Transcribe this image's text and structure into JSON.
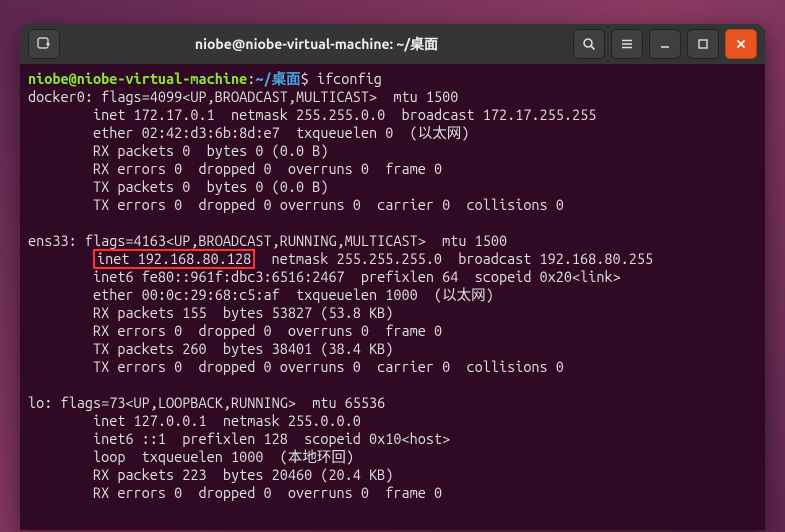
{
  "titlebar": {
    "title": "niobe@niobe-virtual-machine: ~/桌面"
  },
  "prompt": {
    "user_host": "niobe@niobe-virtual-machine",
    "path": "~/桌面",
    "dollar": "$",
    "command": "ifconfig"
  },
  "interfaces": [
    {
      "name": "docker0",
      "header": "docker0: flags=4099<UP,BROADCAST,MULTICAST>  mtu 1500",
      "lines": [
        "        inet 172.17.0.1  netmask 255.255.0.0  broadcast 172.17.255.255",
        "        ether 02:42:d3:6b:8d:e7  txqueuelen 0  (以太网)",
        "        RX packets 0  bytes 0 (0.0 B)",
        "        RX errors 0  dropped 0  overruns 0  frame 0",
        "        TX packets 0  bytes 0 (0.0 B)",
        "        TX errors 0  dropped 0 overruns 0  carrier 0  collisions 0"
      ]
    },
    {
      "name": "ens33",
      "header": "ens33: flags=4163<UP,BROADCAST,RUNNING,MULTICAST>  mtu 1500",
      "inet_prefix": "        ",
      "inet_highlight": "inet 192.168.80.128",
      "inet_suffix": "  netmask 255.255.255.0  broadcast 192.168.80.255",
      "lines": [
        "        inet6 fe80::961f:dbc3:6516:2467  prefixlen 64  scopeid 0x20<link>",
        "        ether 00:0c:29:68:c5:af  txqueuelen 1000  (以太网)",
        "        RX packets 155  bytes 53827 (53.8 KB)",
        "        RX errors 0  dropped 0  overruns 0  frame 0",
        "        TX packets 260  bytes 38401 (38.4 KB)",
        "        TX errors 0  dropped 0 overruns 0  carrier 0  collisions 0"
      ]
    },
    {
      "name": "lo",
      "header": "lo: flags=73<UP,LOOPBACK,RUNNING>  mtu 65536",
      "lines": [
        "        inet 127.0.0.1  netmask 255.0.0.0",
        "        inet6 ::1  prefixlen 128  scopeid 0x10<host>",
        "        loop  txqueuelen 1000  (本地环回)",
        "        RX packets 223  bytes 20460 (20.4 KB)",
        "        RX errors 0  dropped 0  overruns 0  frame 0"
      ]
    }
  ]
}
